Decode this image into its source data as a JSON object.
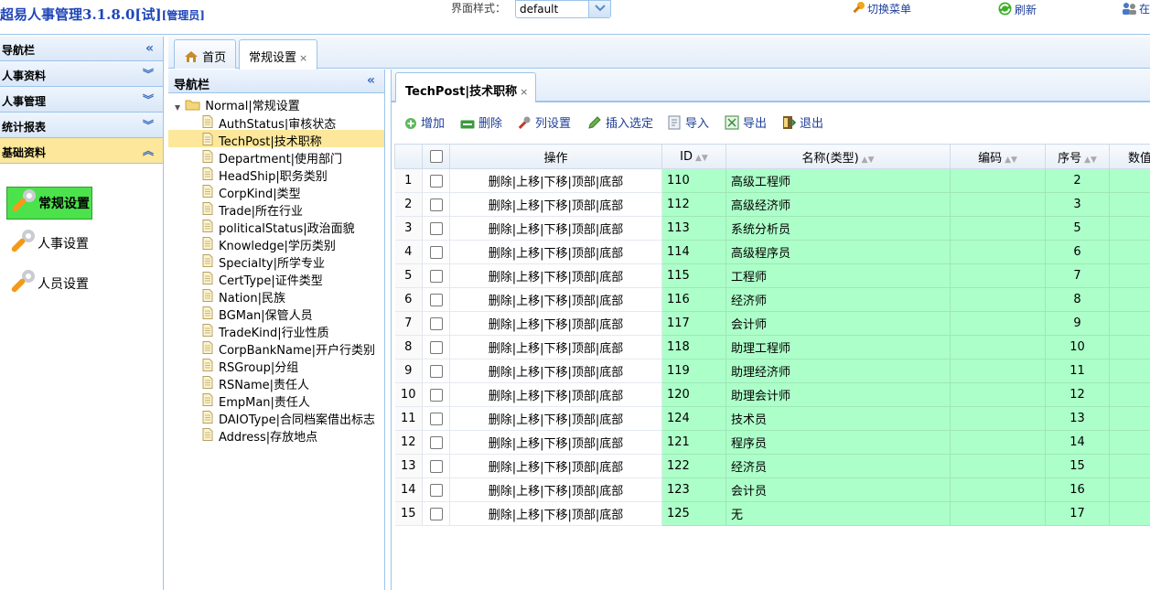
{
  "header": {
    "app_title": "超易人事管理3.1.8.0[试]",
    "role": "[管理员]",
    "theme_label": "界面样式：",
    "theme_value": "default",
    "switch_menu": "切换菜单",
    "refresh": "刷新",
    "extra": "在"
  },
  "sidebar": {
    "title": "导航栏",
    "sections": [
      {
        "label": "人事资料"
      },
      {
        "label": "人事管理"
      },
      {
        "label": "统计报表"
      },
      {
        "label": "基础资料"
      }
    ],
    "items": [
      {
        "label": "常规设置"
      },
      {
        "label": "人事设置"
      },
      {
        "label": "人员设置"
      }
    ]
  },
  "tabs": [
    {
      "label": "首页"
    },
    {
      "label": "常规设置"
    }
  ],
  "midnav": {
    "title": "导航栏",
    "root": "Normal|常规设置",
    "nodes": [
      "AuthStatus|审核状态",
      "TechPost|技术职称",
      "Department|使用部门",
      "HeadShip|职务类别",
      "CorpKind|类型",
      "Trade|所在行业",
      "politicalStatus|政治面貌",
      "Knowledge|学历类别",
      "Specialty|所学专业",
      "CertType|证件类型",
      "Nation|民族",
      "BGMan|保管人员",
      "TradeKind|行业性质",
      "CorpBankName|开户行类别",
      "RSGroup|分组",
      "RSName|责任人",
      "EmpMan|责任人",
      "DAIOType|合同档案借出标志",
      "Address|存放地点"
    ]
  },
  "content": {
    "tab_label": "TechPost|技术职称",
    "toolbar": {
      "add": "增加",
      "delete": "删除",
      "columns": "列设置",
      "insert": "插入选定",
      "import": "导入",
      "export": "导出",
      "exit": "退出"
    },
    "columns": {
      "ops": "操作",
      "id": "ID",
      "name": "名称(类型)",
      "code": "编码",
      "order": "序号",
      "value": "数值"
    },
    "row_ops": "删除|上移|下移|顶部|底部",
    "rows": [
      {
        "n": "1",
        "id": "110",
        "name": "高级工程师",
        "order": "2"
      },
      {
        "n": "2",
        "id": "112",
        "name": "高级经济师",
        "order": "3"
      },
      {
        "n": "3",
        "id": "113",
        "name": "系统分析员",
        "order": "5"
      },
      {
        "n": "4",
        "id": "114",
        "name": "高级程序员",
        "order": "6"
      },
      {
        "n": "5",
        "id": "115",
        "name": "工程师",
        "order": "7"
      },
      {
        "n": "6",
        "id": "116",
        "name": "经济师",
        "order": "8"
      },
      {
        "n": "7",
        "id": "117",
        "name": "会计师",
        "order": "9"
      },
      {
        "n": "8",
        "id": "118",
        "name": "助理工程师",
        "order": "10"
      },
      {
        "n": "9",
        "id": "119",
        "name": "助理经济师",
        "order": "11"
      },
      {
        "n": "10",
        "id": "120",
        "name": "助理会计师",
        "order": "12"
      },
      {
        "n": "11",
        "id": "124",
        "name": "技术员",
        "order": "13"
      },
      {
        "n": "12",
        "id": "121",
        "name": "程序员",
        "order": "14"
      },
      {
        "n": "13",
        "id": "122",
        "name": "经济员",
        "order": "15"
      },
      {
        "n": "14",
        "id": "123",
        "name": "会计员",
        "order": "16"
      },
      {
        "n": "15",
        "id": "125",
        "name": "无",
        "order": "17"
      }
    ]
  }
}
